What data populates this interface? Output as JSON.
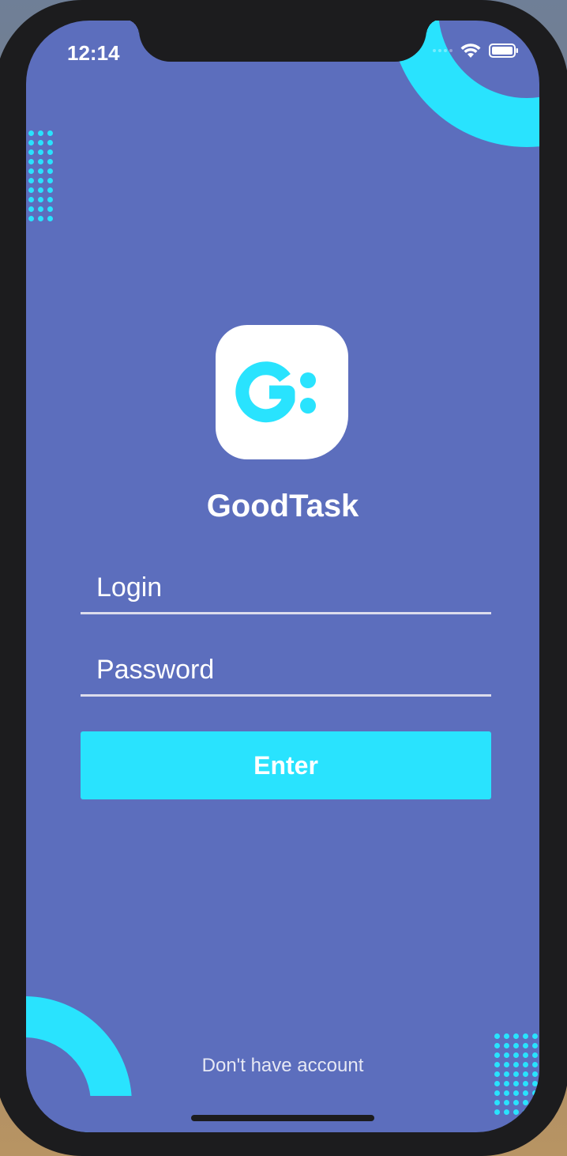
{
  "status_bar": {
    "time": "12:14",
    "icons": [
      "signal-icon",
      "wifi-icon",
      "battery-icon"
    ]
  },
  "app": {
    "logo_icon": "goodtask-logo-icon",
    "title": "GoodTask"
  },
  "form": {
    "login_placeholder": "Login",
    "login_value": "",
    "password_placeholder": "Password",
    "password_value": "",
    "enter_label": "Enter"
  },
  "footer": {
    "signup_link": "Don't have account"
  },
  "colors": {
    "background": "#5c6ebd",
    "accent": "#29e3fe",
    "text": "#ffffff"
  }
}
